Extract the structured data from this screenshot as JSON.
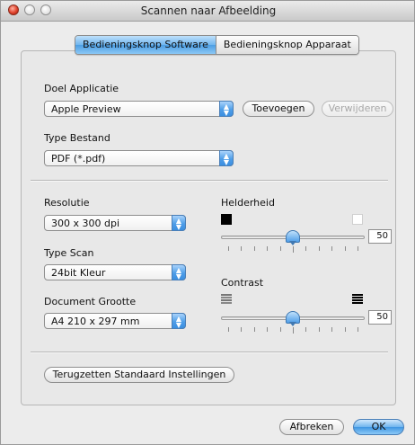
{
  "window": {
    "title": "Scannen naar Afbeelding"
  },
  "tabs": [
    {
      "label": "Bedieningsknop Software",
      "active": true
    },
    {
      "label": "Bedieningsknop Apparaat",
      "active": false
    }
  ],
  "target_app": {
    "label": "Doel Applicatie",
    "value": "Apple Preview",
    "add_button": "Toevoegen",
    "remove_button": "Verwijderen"
  },
  "file_type": {
    "label": "Type Bestand",
    "value": "PDF (*.pdf)"
  },
  "resolution": {
    "label": "Resolutie",
    "value": "300 x 300 dpi"
  },
  "scan_type": {
    "label": "Type Scan",
    "value": "24bit Kleur"
  },
  "document_size": {
    "label": "Document Grootte",
    "value": "A4 210 x 297 mm"
  },
  "brightness": {
    "label": "Helderheid",
    "value": "50",
    "level": 0.5
  },
  "contrast": {
    "label": "Contrast",
    "value": "50",
    "level": 0.5
  },
  "reset_button": "Terugzetten Standaard Instellingen",
  "cancel_button": "Afbreken",
  "ok_button": "OK",
  "colors": {
    "accent": "#4f9ee8",
    "window_bg": "#ececec"
  }
}
